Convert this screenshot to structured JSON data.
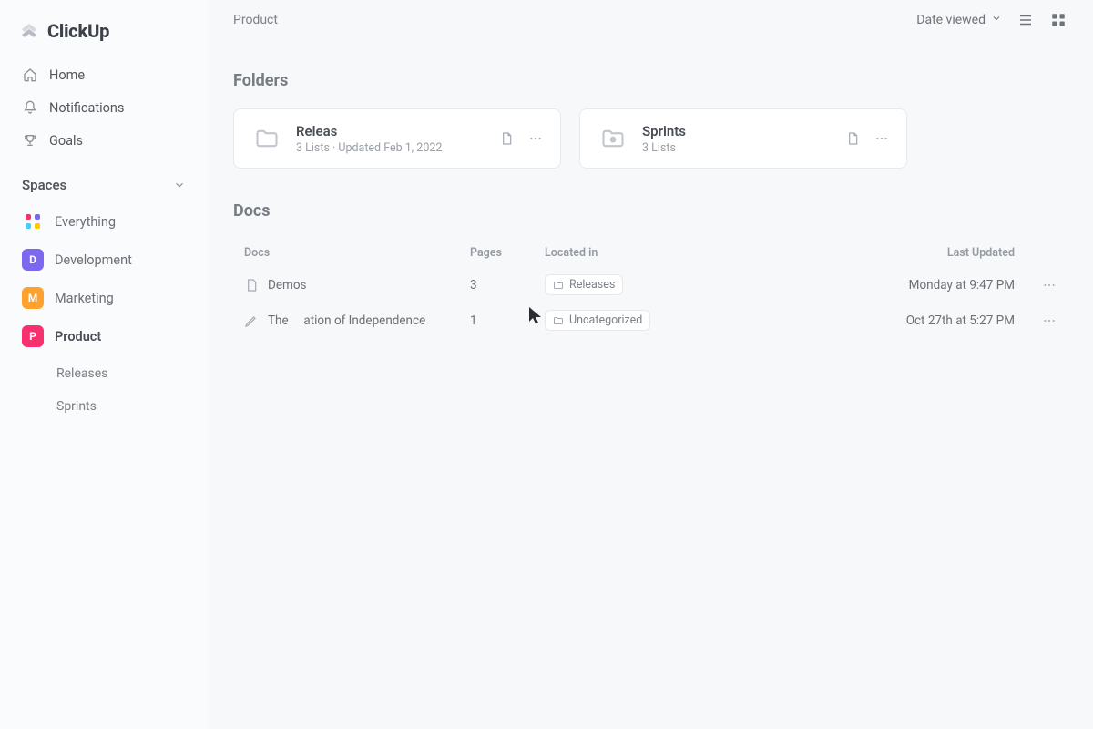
{
  "brand": {
    "name": "ClickUp"
  },
  "sidebar": {
    "home": "Home",
    "notifications": "Notifications",
    "goals": "Goals",
    "spaces_label": "Spaces",
    "everything": "Everything",
    "spaces": [
      {
        "label": "Development",
        "initial": "D"
      },
      {
        "label": "Marketing",
        "initial": "M"
      },
      {
        "label": "Product",
        "initial": "P"
      }
    ],
    "product_children": [
      "Releases",
      "Sprints"
    ]
  },
  "topbar": {
    "breadcrumb": "Product",
    "sort_label": "Date viewed"
  },
  "folders": {
    "title": "Folders",
    "cards": [
      {
        "name": "Releas",
        "sub": "3 Lists · Updated Feb 1, 2022"
      },
      {
        "name": "Sprints",
        "sub": "3 Lists"
      }
    ]
  },
  "docs": {
    "title": "Docs",
    "columns": {
      "doc": "Docs",
      "pages": "Pages",
      "located": "Located in",
      "updated": "Last Updated"
    },
    "rows": [
      {
        "name": "Demos",
        "pages": "3",
        "located": "Releases",
        "updated": "Monday at 9:47 PM"
      },
      {
        "name": "The     ation of Independence",
        "pages": "1",
        "located": "Uncategorized",
        "updated": "Oct 27th at 5:27 PM"
      }
    ]
  }
}
